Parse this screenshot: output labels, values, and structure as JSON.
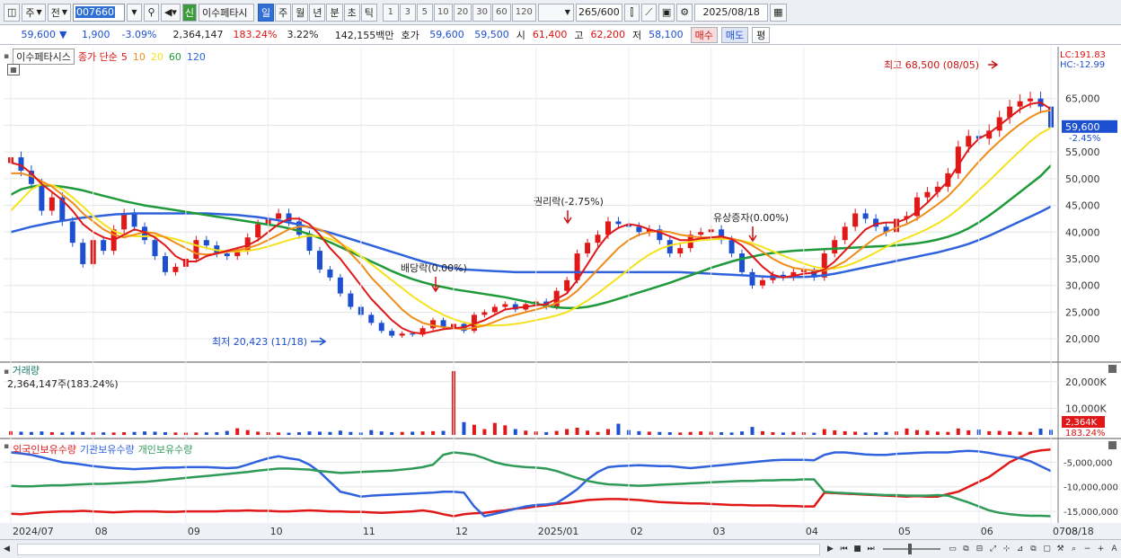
{
  "toolbar": {
    "period_main": "주",
    "prev_label": "전",
    "code": "007660",
    "stock_name": "이수페타시",
    "stock_flag": "신",
    "periods": [
      "일",
      "주",
      "월",
      "년",
      "분",
      "초",
      "틱"
    ],
    "active_period": "일",
    "intervals": [
      "1",
      "3",
      "5",
      "10",
      "20",
      "30",
      "60",
      "120"
    ],
    "count_value": "265",
    "count_total": "/600",
    "date": "2025/08/18"
  },
  "quote": {
    "price": "59,600",
    "change_symbol": "▼",
    "change": "1,900",
    "change_pct": "-3.09%",
    "volume": "2,364,147",
    "volume_ratio": "183.24%",
    "turnover_pct": "3.22%",
    "amount": "142,155백만",
    "ask_label": "호가",
    "bid_price": "59,600",
    "ask_price": "59,500",
    "open_label": "시",
    "open": "61,400",
    "high_label": "고",
    "high": "62,200",
    "low_label": "저",
    "low": "58,100",
    "buy_label": "매수",
    "sell_label": "매도",
    "eval_label": "평"
  },
  "price_panel": {
    "stock_name": "이수페타시스",
    "ma_label": "종가 단순",
    "ma_periods": [
      "5",
      "10",
      "20",
      "60",
      "120"
    ],
    "ma_colors": [
      "#e01818",
      "#f08c1a",
      "#f5e21c",
      "#1f9a3a",
      "#2f62dc"
    ],
    "lc": "LC:191.83",
    "hc": "HC:-12.99",
    "current_price": "59,600",
    "current_pct": "-2.45%",
    "annotations": {
      "high": "최고 68,500 (08/05)",
      "low": "최저 20,423 (11/18)",
      "dividend": "배당락(0.00%)",
      "rights": "권리락(-2.75%)",
      "capital": "유상증자(0.00%)"
    }
  },
  "volume_panel": {
    "title": "거래량",
    "value": "2,364,147주(183.24%)",
    "badge_value": "2,364K",
    "badge_pct": "183.24%"
  },
  "holdings_panel": {
    "legend": [
      "외국인보유수량",
      "기관보유수량",
      "개인보유수량"
    ],
    "colors": [
      "#e01818",
      "#2f62dc",
      "#2f9a58"
    ]
  },
  "x_axis_labels": [
    "2024/07",
    "08",
    "09",
    "10",
    "11",
    "12",
    "2025/01",
    "02",
    "03",
    "04",
    "05",
    "06",
    "07",
    "08",
    "08/18"
  ],
  "chart_data": [
    {
      "type": "candlestick",
      "y_axis_ticks": [
        "65,000",
        "60,000",
        "55,000",
        "50,000",
        "45,000",
        "40,000",
        "35,000",
        "30,000",
        "25,000",
        "20,000"
      ],
      "ylim": [
        17500,
        70000
      ],
      "close": [
        54000,
        51500,
        49000,
        44000,
        46500,
        42000,
        38000,
        34000,
        38500,
        36500,
        40500,
        43500,
        41000,
        38500,
        35500,
        32500,
        33500,
        35000,
        38500,
        37500,
        36000,
        35500,
        36500,
        39000,
        41500,
        42500,
        43500,
        42000,
        39500,
        36500,
        33000,
        31500,
        28500,
        26000,
        24500,
        23000,
        21500,
        20600,
        21000,
        20800,
        22000,
        23500,
        22200,
        22800,
        21500,
        24500,
        25000,
        26000,
        26500,
        25500,
        26500,
        27000,
        26000,
        29000,
        31000,
        36000,
        38000,
        39500,
        42000,
        41500,
        41000,
        40000,
        40500,
        38500,
        36000,
        37000,
        39500,
        40000,
        40500,
        38500,
        36000,
        32500,
        30000,
        31000,
        32000,
        31500,
        32500,
        33000,
        31500,
        36000,
        38500,
        41000,
        43500,
        42500,
        41000,
        40000,
        42500,
        43000,
        46500,
        47500,
        48500,
        51000,
        56000,
        58000,
        57500,
        59000,
        61500,
        63500,
        64500,
        65000,
        63500,
        59600
      ],
      "ma5": [
        53000,
        52500,
        51000,
        49000,
        47500,
        46000,
        44000,
        41500,
        40000,
        39000,
        38500,
        39500,
        40500,
        40000,
        39000,
        37500,
        35500,
        34500,
        34500,
        35500,
        36000,
        36500,
        37000,
        37500,
        38500,
        40000,
        41500,
        42500,
        42500,
        41500,
        39500,
        37000,
        35000,
        32500,
        30000,
        27500,
        25500,
        23500,
        22000,
        21200,
        21000,
        21400,
        21800,
        22000,
        22200,
        22800,
        23500,
        24500,
        25500,
        25800,
        26000,
        26300,
        26500,
        27500,
        28500,
        31000,
        34000,
        37000,
        39500,
        40800,
        41500,
        41200,
        40500,
        40000,
        39200,
        38500,
        38500,
        38800,
        39000,
        39200,
        38700,
        37500,
        35500,
        33500,
        32000,
        31500,
        31800,
        32200,
        32400,
        33000,
        34500,
        36500,
        38500,
        40500,
        41500,
        41800,
        41800,
        42500,
        43800,
        45500,
        47500,
        49500,
        52500,
        55500,
        57500,
        58500,
        60000,
        61500,
        63000,
        64000,
        64300,
        63000
      ],
      "ma10": [
        51000,
        51000,
        50500,
        49500,
        48500,
        47000,
        45500,
        43500,
        42000,
        40500,
        39500,
        39000,
        39500,
        40000,
        39800,
        39000,
        38000,
        37000,
        36000,
        35800,
        36000,
        36300,
        36600,
        37000,
        37600,
        38500,
        39500,
        40500,
        41000,
        41000,
        40500,
        39500,
        38000,
        36000,
        34000,
        31500,
        29500,
        27500,
        25500,
        24000,
        23000,
        22500,
        22200,
        22000,
        21800,
        22100,
        22500,
        23200,
        24000,
        24500,
        25000,
        25500,
        26000,
        26700,
        27500,
        29000,
        31000,
        33000,
        35000,
        37000,
        38500,
        39500,
        40000,
        40200,
        40000,
        39500,
        39200,
        39000,
        39000,
        39000,
        38800,
        38300,
        37500,
        36300,
        35000,
        34000,
        33300,
        33000,
        32800,
        32800,
        33500,
        34500,
        36000,
        37500,
        39000,
        40000,
        40800,
        41500,
        42500,
        43800,
        45200,
        46700,
        48700,
        51000,
        53200,
        55200,
        57000,
        58700,
        60200,
        61500,
        62500,
        62800
      ],
      "ma20": [
        44000,
        46000,
        48000,
        49000,
        48800,
        48000,
        46500,
        44800,
        43000,
        41500,
        40200,
        39500,
        39200,
        39200,
        39300,
        39100,
        38700,
        38100,
        37500,
        37000,
        36600,
        36400,
        36400,
        36500,
        36800,
        37300,
        37900,
        38500,
        39000,
        39300,
        39200,
        38700,
        37900,
        36800,
        35500,
        34000,
        32500,
        31000,
        29500,
        28000,
        26700,
        25500,
        24500,
        23700,
        23100,
        22700,
        22500,
        22500,
        22600,
        22800,
        23100,
        23500,
        23900,
        24400,
        25000,
        26000,
        27200,
        28500,
        30000,
        31500,
        33000,
        34500,
        35800,
        36800,
        37500,
        37900,
        38200,
        38500,
        38600,
        38700,
        38700,
        38400,
        37900,
        37200,
        36400,
        35600,
        34800,
        34100,
        33500,
        33100,
        33200,
        33600,
        34300,
        35200,
        36200,
        37200,
        38100,
        38900,
        39700,
        40600,
        41600,
        42800,
        44300,
        46000,
        47800,
        49600,
        51500,
        53400,
        55200,
        57000,
        58500,
        59500
      ],
      "ma60": [
        47000,
        48000,
        48500,
        48800,
        48700,
        48500,
        48200,
        47800,
        47300,
        46800,
        46300,
        45800,
        45400,
        45000,
        44700,
        44400,
        44100,
        43800,
        43500,
        43200,
        42900,
        42600,
        42300,
        42000,
        41700,
        41400,
        41100,
        40700,
        40200,
        39600,
        38900,
        38100,
        37200,
        36300,
        35400,
        34500,
        33600,
        32700,
        31900,
        31200,
        30600,
        30100,
        29700,
        29300,
        29000,
        28700,
        28400,
        28100,
        27800,
        27400,
        27000,
        26600,
        26200,
        25900,
        25800,
        25800,
        26000,
        26400,
        26900,
        27500,
        28100,
        28700,
        29300,
        29900,
        30500,
        31200,
        31900,
        32600,
        33300,
        33900,
        34500,
        35000,
        35400,
        35800,
        36100,
        36300,
        36500,
        36600,
        36700,
        36800,
        36900,
        37000,
        37100,
        37200,
        37300,
        37400,
        37500,
        37700,
        37900,
        38200,
        38600,
        39100,
        39800,
        40700,
        41800,
        43100,
        44500,
        46000,
        47500,
        49000,
        50500,
        52500
      ],
      "ma120": [
        40000,
        40500,
        41000,
        41400,
        41800,
        42100,
        42400,
        42700,
        42900,
        43100,
        43300,
        43400,
        43500,
        43500,
        43500,
        43500,
        43500,
        43500,
        43500,
        43500,
        43400,
        43300,
        43200,
        43000,
        42800,
        42500,
        42200,
        41800,
        41400,
        40900,
        40400,
        39900,
        39300,
        38700,
        38100,
        37500,
        36900,
        36300,
        35700,
        35100,
        34500,
        34000,
        33500,
        33200,
        33000,
        32900,
        32800,
        32700,
        32600,
        32500,
        32500,
        32500,
        32500,
        32500,
        32500,
        32500,
        32500,
        32500,
        32500,
        32500,
        32500,
        32500,
        32500,
        32500,
        32500,
        32500,
        32400,
        32300,
        32200,
        32100,
        32000,
        31900,
        31800,
        31700,
        31600,
        31600,
        31600,
        31600,
        31700,
        31900,
        32200,
        32600,
        33000,
        33400,
        33800,
        34200,
        34600,
        35000,
        35400,
        35800,
        36200,
        36700,
        37200,
        37800,
        38500,
        39300,
        40200,
        41100,
        42000,
        42900,
        43800,
        44800
      ],
      "volume_k": [
        1400,
        1200,
        1100,
        1300,
        1000,
        900,
        1200,
        1100,
        1000,
        950,
        900,
        1000,
        1100,
        1300,
        1200,
        1000,
        900,
        850,
        900,
        950,
        1000,
        1500,
        2500,
        1800,
        1200,
        1000,
        900,
        800,
        1000,
        1300,
        1200,
        1100,
        1600,
        1100,
        900,
        1800,
        1300,
        1000,
        1100,
        1200,
        1300,
        1400,
        1500,
        24000,
        4800,
        3800,
        2200,
        4500,
        3600,
        2200,
        1600,
        1300,
        1000,
        1500,
        2200,
        2700,
        1600,
        1100,
        2200,
        4200,
        1800,
        1400,
        1200,
        1100,
        1000,
        900,
        1100,
        1300,
        1200,
        1000,
        900,
        1300,
        3000,
        1400,
        1000,
        900,
        1100,
        1000,
        800,
        2200,
        1700,
        1400,
        1200,
        900,
        1000,
        1100,
        1300,
        2400,
        1800,
        1600,
        1200,
        1100,
        2400,
        1700,
        2000,
        1400,
        1500,
        1300,
        1200,
        1100,
        2364,
        1900
      ],
      "volume_ylim": [
        0,
        25000
      ],
      "volume_ticks": [
        "20,000K",
        "10,000K"
      ],
      "holdings_series": [
        {
          "name": "외국인보유수량",
          "values": [
            -15500,
            -15600,
            -15400,
            -15200,
            -15100,
            -15000,
            -15000,
            -14900,
            -15000,
            -15100,
            -15200,
            -15100,
            -15000,
            -15000,
            -15000,
            -15100,
            -15100,
            -15000,
            -15000,
            -15000,
            -15000,
            -14900,
            -14900,
            -14800,
            -14900,
            -14900,
            -15000,
            -15000,
            -14900,
            -14800,
            -14900,
            -15000,
            -15000,
            -15100,
            -15100,
            -15200,
            -15300,
            -15200,
            -15100,
            -15000,
            -14800,
            -15100,
            -15600,
            -16000,
            -15600,
            -15400,
            -15300,
            -15000,
            -14800,
            -14500,
            -14300,
            -14000,
            -13800,
            -13500,
            -13300,
            -13000,
            -12700,
            -12600,
            -12500,
            -12500,
            -12600,
            -12700,
            -12900,
            -13100,
            -13200,
            -13300,
            -13400,
            -13400,
            -13500,
            -13600,
            -13700,
            -13700,
            -13800,
            -13800,
            -13800,
            -13900,
            -13900,
            -14000,
            -14000,
            -11200,
            -11300,
            -11400,
            -11500,
            -11600,
            -11700,
            -11800,
            -11900,
            -12000,
            -11900,
            -12000,
            -12000,
            -11500,
            -11000,
            -10000,
            -9000,
            -8000,
            -6500,
            -5000,
            -4000,
            -3000,
            -2600,
            -2400
          ]
        },
        {
          "name": "기관보유수량",
          "values": [
            -3000,
            -3200,
            -3500,
            -4000,
            -4500,
            -5000,
            -5200,
            -5500,
            -5800,
            -6000,
            -6200,
            -6300,
            -6400,
            -6300,
            -6200,
            -6100,
            -6100,
            -6000,
            -6000,
            -6000,
            -6100,
            -6200,
            -6100,
            -5500,
            -4800,
            -4200,
            -3800,
            -4200,
            -4500,
            -5500,
            -7000,
            -9000,
            -11000,
            -11500,
            -12000,
            -11800,
            -11700,
            -11600,
            -11500,
            -11400,
            -11300,
            -11200,
            -11000,
            -11000,
            -11200,
            -14000,
            -16000,
            -15500,
            -15000,
            -14500,
            -14000,
            -13700,
            -13600,
            -13300,
            -12000,
            -10500,
            -8500,
            -7000,
            -6000,
            -5800,
            -5700,
            -5600,
            -5700,
            -5800,
            -5800,
            -6000,
            -6200,
            -6000,
            -5800,
            -5600,
            -5400,
            -5200,
            -5000,
            -4800,
            -4600,
            -4500,
            -4500,
            -4500,
            -4600,
            -3500,
            -3000,
            -3000,
            -3200,
            -3400,
            -3500,
            -3500,
            -3300,
            -3200,
            -3100,
            -3000,
            -3000,
            -3000,
            -2800,
            -2700,
            -2800,
            -3100,
            -3500,
            -3800,
            -4200,
            -4800,
            -5800,
            -6800
          ]
        },
        {
          "name": "개인보유수량",
          "values": [
            -9800,
            -9900,
            -9900,
            -9800,
            -9700,
            -9700,
            -9600,
            -9500,
            -9400,
            -9400,
            -9300,
            -9200,
            -9100,
            -9000,
            -8800,
            -8600,
            -8400,
            -8200,
            -8000,
            -7800,
            -7600,
            -7400,
            -7200,
            -7000,
            -6700,
            -6500,
            -6300,
            -6300,
            -6400,
            -6500,
            -6800,
            -7000,
            -7200,
            -7100,
            -7000,
            -6900,
            -6800,
            -6700,
            -6500,
            -6300,
            -6000,
            -5500,
            -3500,
            -3000,
            -3200,
            -3500,
            -4200,
            -5000,
            -5500,
            -5800,
            -6000,
            -6100,
            -6300,
            -6800,
            -7500,
            -8200,
            -8800,
            -9200,
            -9500,
            -9600,
            -9700,
            -9800,
            -9700,
            -9600,
            -9500,
            -9400,
            -9300,
            -9200,
            -9100,
            -9000,
            -8900,
            -8800,
            -8800,
            -8700,
            -8700,
            -8600,
            -8600,
            -8500,
            -8500,
            -11000,
            -11200,
            -11300,
            -11400,
            -11500,
            -11600,
            -11700,
            -11700,
            -11800,
            -11800,
            -11800,
            -11700,
            -11800,
            -12500,
            -13200,
            -14000,
            -14800,
            -15300,
            -15600,
            -15800,
            -15900,
            -15900,
            -16000
          ]
        }
      ],
      "holdings_ylim": [
        -17000,
        -2000
      ],
      "holdings_ticks": [
        "-5,000,000",
        "-10,000,000",
        "-15,000,000"
      ]
    }
  ]
}
